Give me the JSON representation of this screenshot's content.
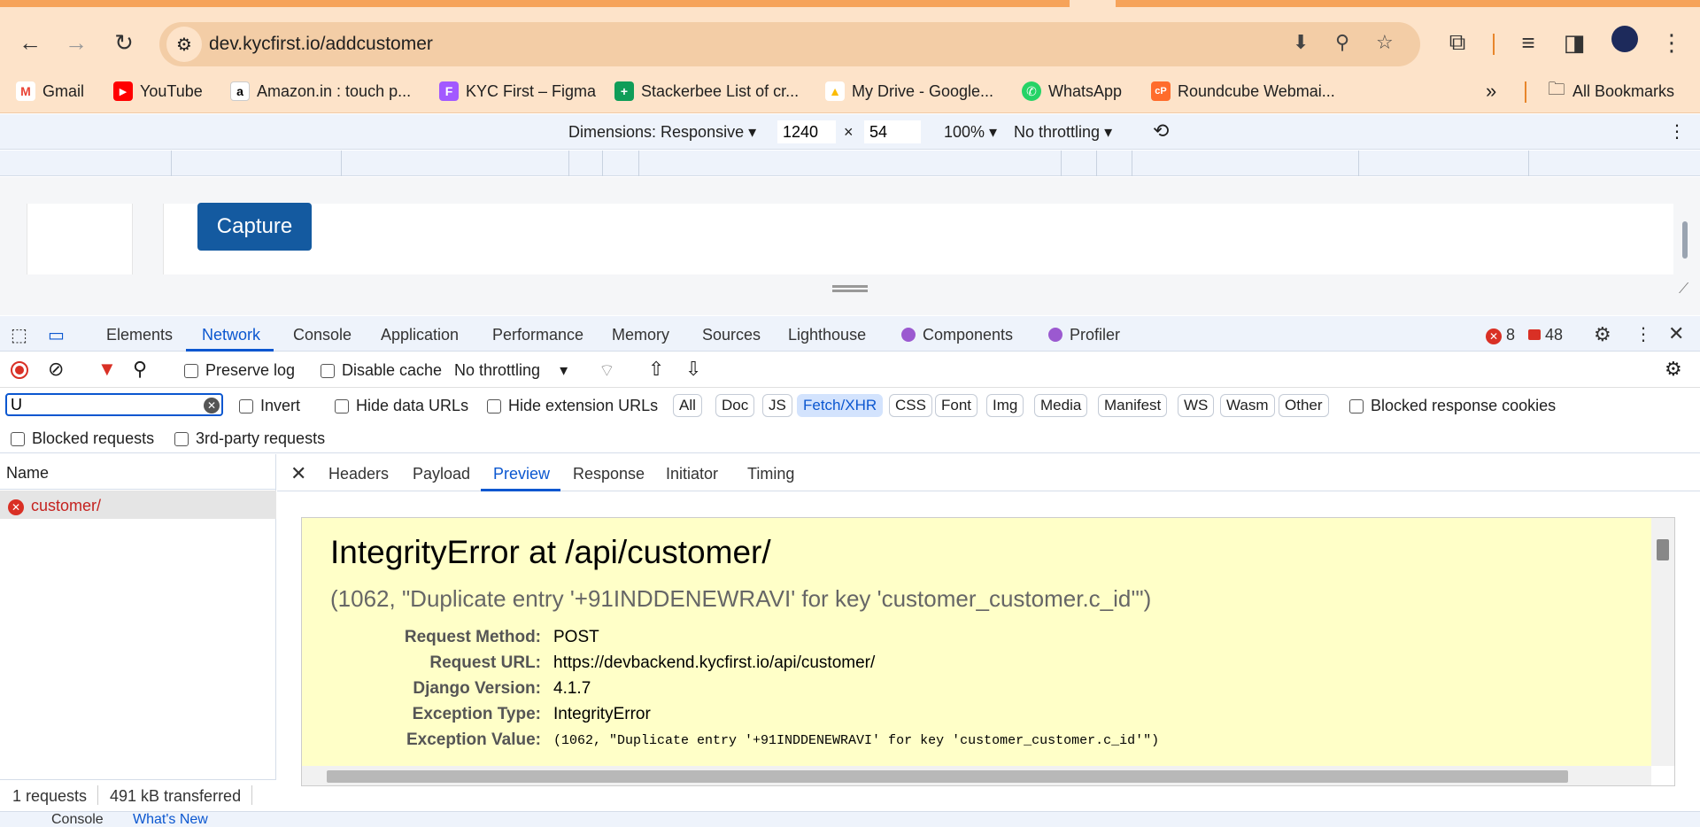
{
  "browser": {
    "url": "dev.kycfirst.io/addcustomer",
    "bookmarks": [
      {
        "label": "Gmail",
        "fav": "M",
        "color": "#ea4335"
      },
      {
        "label": "YouTube",
        "fav": "▶",
        "color": "#ff0000"
      },
      {
        "label": "Amazon.in : touch p...",
        "fav": "a",
        "color": "#000000"
      },
      {
        "label": "KYC First – Figma",
        "fav": "F",
        "color": "#a259ff"
      },
      {
        "label": "Stackerbee List of cr...",
        "fav": "+",
        "color": "#0f9d58"
      },
      {
        "label": "My Drive - Google...",
        "fav": "▲",
        "color": "#fbbc04"
      },
      {
        "label": "WhatsApp",
        "fav": "✆",
        "color": "#25d366"
      },
      {
        "label": "Roundcube Webmai...",
        "fav": "cP",
        "color": "#ff6c2c"
      }
    ],
    "overflow": "»",
    "all_bookmarks": "All Bookmarks"
  },
  "device_toolbar": {
    "dimensions": "Dimensions: Responsive",
    "width": "1240",
    "times": "×",
    "height": "54",
    "zoom": "100%",
    "throttle": "No throttling"
  },
  "page": {
    "capture_label": "Capture"
  },
  "devtools": {
    "tabs": [
      "Elements",
      "Network",
      "Console",
      "Application",
      "Performance",
      "Memory",
      "Sources",
      "Lighthouse",
      "Components",
      "Profiler"
    ],
    "error_count": "8",
    "warning_count": "48",
    "preserve_log": "Preserve log",
    "disable_cache": "Disable cache",
    "throttling": "No throttling",
    "filter_value": "U",
    "invert": "Invert",
    "hide_data_urls": "Hide data URLs",
    "hide_extension_urls": "Hide extension URLs",
    "types": [
      "All",
      "Doc",
      "JS",
      "Fetch/XHR",
      "CSS",
      "Font",
      "Img",
      "Media",
      "Manifest",
      "WS",
      "Wasm",
      "Other"
    ],
    "active_type": "Fetch/XHR",
    "blocked_response_cookies": "Blocked response cookies",
    "blocked_requests": "Blocked requests",
    "third_party": "3rd-party requests",
    "name_header": "Name",
    "request_name": "customer/",
    "requests_count": "1 requests",
    "transferred": "491 kB transferred",
    "detail_tabs": [
      "Headers",
      "Payload",
      "Preview",
      "Response",
      "Initiator",
      "Timing"
    ],
    "active_detail_tab": "Preview"
  },
  "error_page": {
    "title": "IntegrityError at /api/customer/",
    "subtitle": "(1062, \"Duplicate entry '+91INDDENEWRAVI' for key 'customer_customer.c_id'\")",
    "meta": [
      {
        "k": "Request Method:",
        "v": "POST"
      },
      {
        "k": "Request URL:",
        "v": "https://devbackend.kycfirst.io/api/customer/"
      },
      {
        "k": "Django Version:",
        "v": "4.1.7"
      },
      {
        "k": "Exception Type:",
        "v": "IntegrityError"
      },
      {
        "k": "Exception Value:",
        "v": "(1062, \"Duplicate entry '+91INDDENEWRAVI' for key 'customer_customer.c_id'\")"
      }
    ]
  },
  "drawer": {
    "console_label": "Console",
    "whats_new": "What's New"
  }
}
